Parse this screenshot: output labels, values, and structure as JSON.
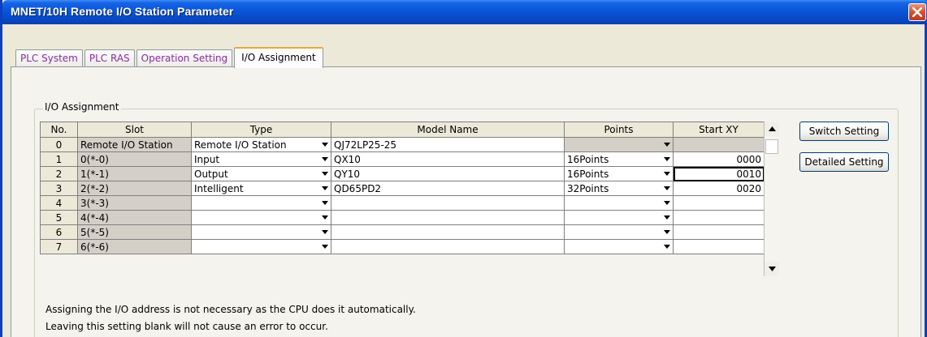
{
  "window": {
    "title": "MNET/10H Remote I/O Station Parameter"
  },
  "tabs": [
    "PLC System",
    "PLC RAS",
    "Operation Setting",
    "I/O Assignment"
  ],
  "active_tab": "I/O Assignment",
  "group_label": "I/O Assignment",
  "columns": [
    "No.",
    "Slot",
    "Type",
    "Model Name",
    "Points",
    "Start XY"
  ],
  "rows": [
    {
      "no": "0",
      "slot": "Remote I/O Station",
      "type": "Remote I/O Station",
      "model": "QJ72LP25-25",
      "points": "",
      "start": ""
    },
    {
      "no": "1",
      "slot": "0(*-0)",
      "type": "Input",
      "model": "QX10",
      "points": "16Points",
      "start": "0000"
    },
    {
      "no": "2",
      "slot": "1(*-1)",
      "type": "Output",
      "model": "QY10",
      "points": "16Points",
      "start": "0010"
    },
    {
      "no": "3",
      "slot": "2(*-2)",
      "type": "Intelligent",
      "model": "QD65PD2",
      "points": "32Points",
      "start": "0020"
    },
    {
      "no": "4",
      "slot": "3(*-3)",
      "type": "",
      "model": "",
      "points": "",
      "start": ""
    },
    {
      "no": "5",
      "slot": "4(*-4)",
      "type": "",
      "model": "",
      "points": "",
      "start": ""
    },
    {
      "no": "6",
      "slot": "5(*-5)",
      "type": "",
      "model": "",
      "points": "",
      "start": ""
    },
    {
      "no": "7",
      "slot": "6(*-6)",
      "type": "",
      "model": "",
      "points": "",
      "start": ""
    }
  ],
  "buttons": {
    "switch_setting": "Switch Setting",
    "detailed_setting": "Detailed Setting"
  },
  "notes": [
    "Assigning the I/O address is not necessary as the CPU does it automatically.",
    "Leaving this setting blank will not cause an error to occur."
  ],
  "colors": {
    "title_bar": "#0a55d8",
    "tab_text": "#8a2d9e",
    "active_tab_accent": "#e7a83a",
    "close_button": "#d4502f"
  },
  "icons": {
    "close": "close-icon",
    "dropdown": "chevron-down-icon",
    "scroll_up": "scroll-up-arrow-icon",
    "scroll_down": "scroll-down-arrow-icon"
  }
}
